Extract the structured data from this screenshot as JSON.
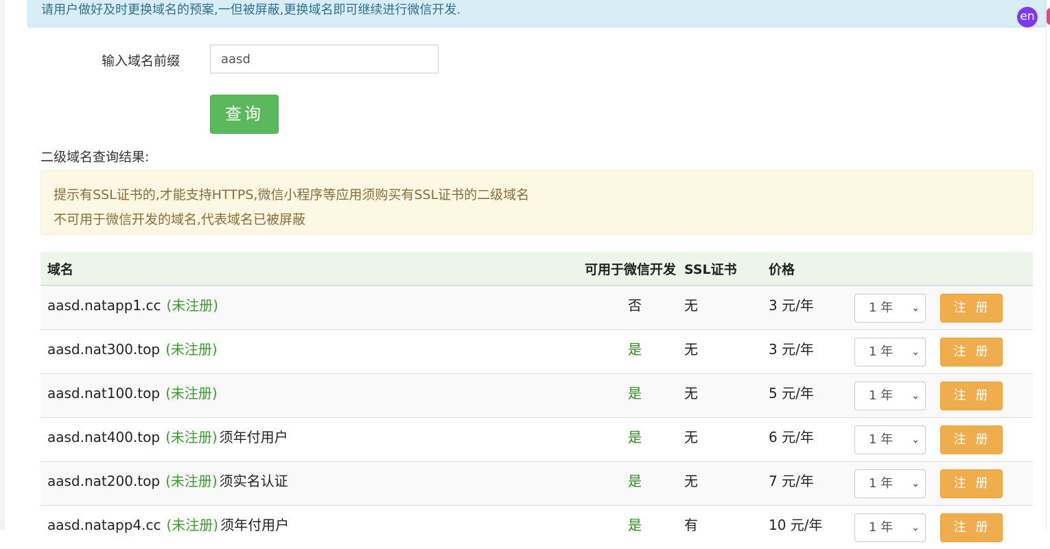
{
  "notice": "请用户做好及时更换域名的预案,一但被屏蔽,更换域名即可继续进行微信开发.",
  "lang_badge": "en",
  "form": {
    "label": "输入域名前缀",
    "value": "aasd",
    "submit_label": "查询"
  },
  "results_title": "二级域名查询结果:",
  "tips": [
    "提示有SSL证书的,才能支持HTTPS,微信小程序等应用须购买有SSL证书的二级域名",
    "不可用于微信开发的域名,代表域名已被屏蔽"
  ],
  "table": {
    "headers": {
      "domain": "域名",
      "wechat": "可用于微信开发",
      "ssl": "SSL证书",
      "price": "价格"
    },
    "rows": [
      {
        "domain": "aasd.natapp1.cc",
        "status": "(未注册)",
        "note": "",
        "wechat": "否",
        "ssl": "无",
        "price": "3 元/年",
        "term": "1 年",
        "action": "注册"
      },
      {
        "domain": "aasd.nat300.top",
        "status": "(未注册)",
        "note": "",
        "wechat": "是",
        "ssl": "无",
        "price": "3 元/年",
        "term": "1 年",
        "action": "注册"
      },
      {
        "domain": "aasd.nat100.top",
        "status": "(未注册)",
        "note": "",
        "wechat": "是",
        "ssl": "无",
        "price": "5 元/年",
        "term": "1 年",
        "action": "注册"
      },
      {
        "domain": "aasd.nat400.top",
        "status": "(未注册)",
        "note": "须年付用户",
        "wechat": "是",
        "ssl": "无",
        "price": "6 元/年",
        "term": "1 年",
        "action": "注册"
      },
      {
        "domain": "aasd.nat200.top",
        "status": "(未注册)",
        "note": "须实名认证",
        "wechat": "是",
        "ssl": "无",
        "price": "7 元/年",
        "term": "1 年",
        "action": "注册"
      },
      {
        "domain": "aasd.natapp4.cc",
        "status": "(未注册)",
        "note": "须年付用户",
        "wechat": "是",
        "ssl": "有",
        "price": "10 元/年",
        "term": "1 年",
        "action": "注册"
      }
    ]
  }
}
